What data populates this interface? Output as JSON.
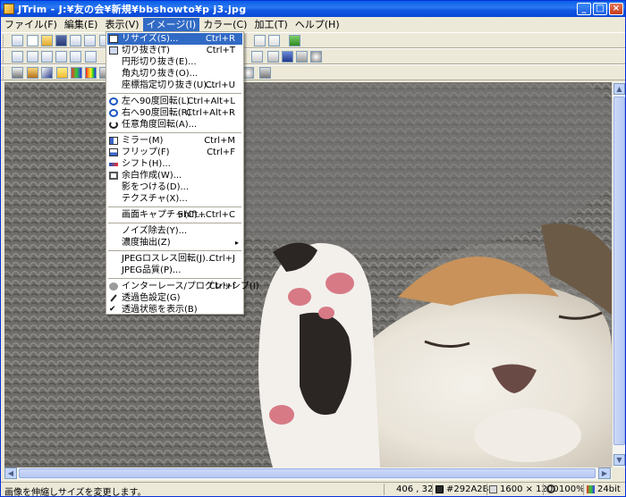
{
  "window": {
    "title": "JTrim - J:¥友の会¥新規¥bbshowto¥p j3.jpg",
    "minimize": "_",
    "maximize": "□",
    "close": "×"
  },
  "menubar": [
    "ファイル(F)",
    "編集(E)",
    "表示(V)",
    "イメージ(I)",
    "カラー(C)",
    "加工(T)",
    "ヘルプ(H)"
  ],
  "dropdown": {
    "items": [
      {
        "label": "リサイズ(S)...",
        "shortcut": "Ctrl+R",
        "icon": "resize-icon"
      },
      {
        "label": "切り抜き(T)",
        "shortcut": "Ctrl+T",
        "icon": "crop-icon"
      },
      {
        "label": "円形切り抜き(E)...",
        "shortcut": "",
        "icon": ""
      },
      {
        "label": "角丸切り抜き(O)...",
        "shortcut": "",
        "icon": ""
      },
      {
        "label": "座標指定切り抜き(U)...",
        "shortcut": "Ctrl+U",
        "icon": ""
      },
      {
        "label": "左へ90度回転(L)",
        "shortcut": "Ctrl+Alt+L",
        "icon": "rotate-left-icon"
      },
      {
        "label": "右へ90度回転(R)",
        "shortcut": "Ctrl+Alt+R",
        "icon": "rotate-right-icon"
      },
      {
        "label": "任意角度回転(A)...",
        "shortcut": "",
        "icon": "rotate-any-icon"
      },
      {
        "label": "ミラー(M)",
        "shortcut": "Ctrl+M",
        "icon": "mirror-icon"
      },
      {
        "label": "フリップ(F)",
        "shortcut": "Ctrl+F",
        "icon": "flip-icon"
      },
      {
        "label": "シフト(H)...",
        "shortcut": "",
        "icon": "shift-icon"
      },
      {
        "label": "余白作成(W)...",
        "shortcut": "",
        "icon": "margin-icon"
      },
      {
        "label": "影をつける(D)...",
        "shortcut": "",
        "icon": ""
      },
      {
        "label": "テクスチャ(X)...",
        "shortcut": "",
        "icon": ""
      },
      {
        "label": "画面キャプチャ(C)...",
        "shortcut": "Shift+Ctrl+C",
        "icon": ""
      },
      {
        "label": "ノイズ除去(Y)...",
        "shortcut": "",
        "icon": ""
      },
      {
        "label": "濃度抽出(Z)",
        "shortcut": "",
        "icon": ""
      },
      {
        "label": "JPEGロスレス回転(J)...",
        "shortcut": "Ctrl+J",
        "icon": ""
      },
      {
        "label": "JPEG品質(P)...",
        "shortcut": "",
        "icon": ""
      },
      {
        "label": "インターレース/プログレッシブ(I)",
        "shortcut": "Ctrl+I",
        "icon": "interlace-icon"
      },
      {
        "label": "透過色設定(G)",
        "shortcut": "",
        "icon": "eyedropper-icon"
      },
      {
        "label": "透過状態を表示(B)",
        "shortcut": "",
        "icon": "checkmark-icon"
      }
    ],
    "submenu_arrow": "▸"
  },
  "status": {
    "message": "画像を伸縮しサイズを変更します。",
    "coords": "406 , 32",
    "color": "#292A2B",
    "size": "1600 × 1200",
    "zoom": "100%",
    "depth": "24bit"
  },
  "colors": {
    "menu_highlight": "#316ac5",
    "titlebar": "#0a5ee8"
  }
}
